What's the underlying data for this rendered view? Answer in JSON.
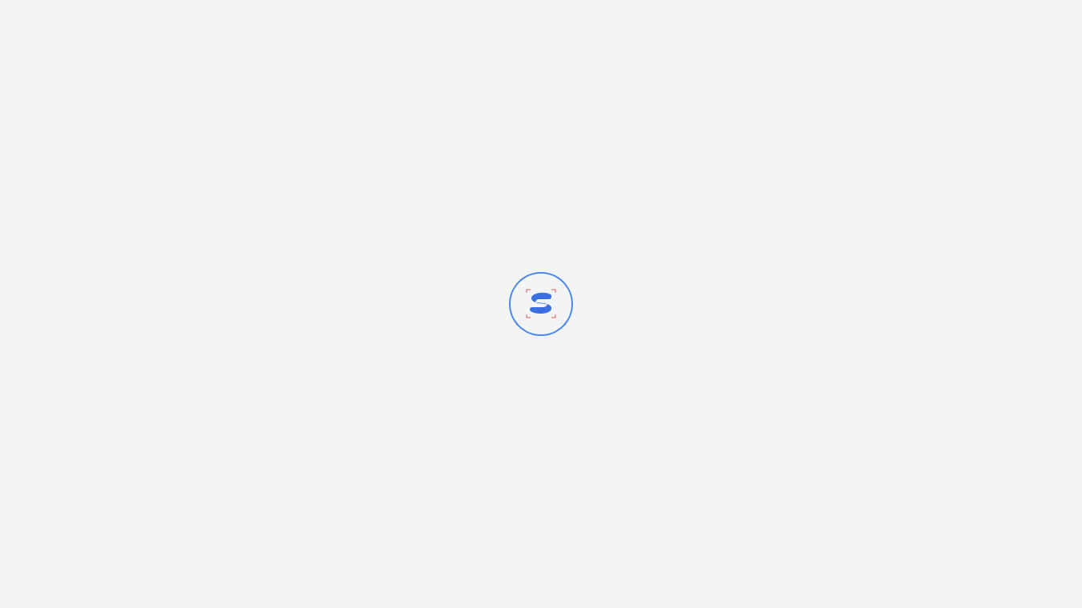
{
  "screen": {
    "state": "loading",
    "background_color": "#f3f4f6"
  },
  "spinner": {
    "ring_color": "#4a86e8"
  },
  "logo": {
    "icon": "brand-s-logo-icon",
    "primary_color": "#3b6fe0",
    "corner_mark_color": "#d9534f"
  }
}
